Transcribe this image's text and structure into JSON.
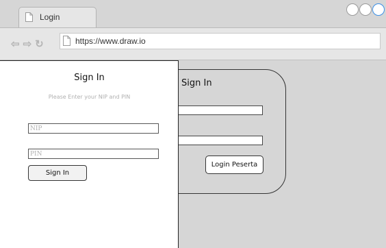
{
  "browser": {
    "tab_title": "Login",
    "url": "https://www.draw.io",
    "nav_icons": [
      "back-arrow-icon",
      "forward-arrow-icon",
      "reload-icon"
    ],
    "window_controls": [
      "minimize-circle-icon",
      "maximize-circle-icon",
      "close-circle-icon"
    ]
  },
  "background_card": {
    "title": "Sign In",
    "button_label": "Login Peserta"
  },
  "panel": {
    "title": "Sign In",
    "subtitle": "Please Enter your NIP and PIN",
    "nip_placeholder": "NIP",
    "pin_placeholder": "PIN",
    "signin_label": "Sign In"
  },
  "colors": {
    "chrome_gray": "#d6d6d6",
    "control_accent": "#3a8ee6",
    "placeholder_gray": "#b0b0b0"
  }
}
